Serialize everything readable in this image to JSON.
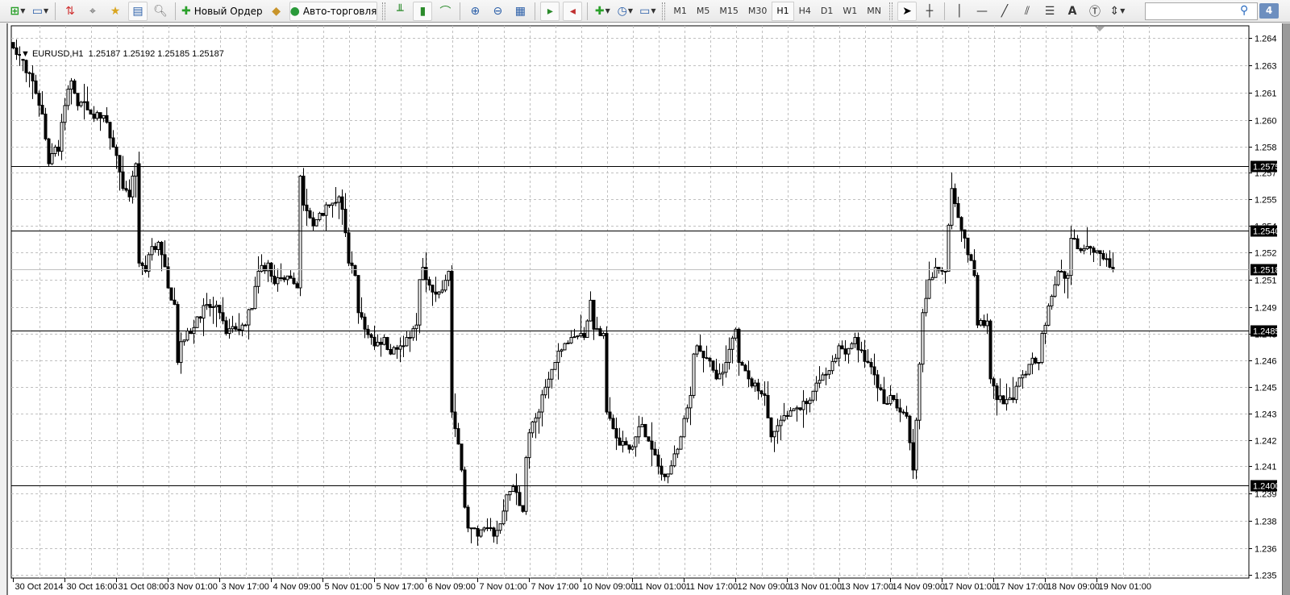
{
  "toolbar": {
    "new_order_label": "Новый Ордер",
    "autotrading_label": "Авто-торговля",
    "timeframes": [
      "M1",
      "M5",
      "M15",
      "M30",
      "H1",
      "H4",
      "D1",
      "W1",
      "MN"
    ],
    "active_timeframe": "H1",
    "search_placeholder": "",
    "badge_count": "4"
  },
  "chart_header": {
    "symbol": "EURUSD,H1",
    "ohlc": "1.25187 1.25192 1.25185 1.25187"
  },
  "colors": {
    "bull_fill": "#ffffff",
    "bear_fill": "#000000",
    "grid": "#c0c0c0",
    "hline": "#000000",
    "current_line": "#c0c0c0",
    "label_bg": "#000000"
  },
  "chart_data": {
    "type": "candlestick",
    "symbol": "EURUSD",
    "timeframe": "H1",
    "ylim": [
      1.2348,
      1.2652
    ],
    "price_ticks": [
      "1.26455",
      "1.26305",
      "1.26155",
      "1.26005",
      "1.25860",
      "1.25715",
      "1.25570",
      "1.25425",
      "1.25280",
      "1.25130",
      "1.24980",
      "1.24830",
      "1.24685",
      "1.24540",
      "1.24395",
      "1.24250",
      "1.24105",
      "1.23955",
      "1.23805",
      "1.23655",
      "1.23510"
    ],
    "time_labels": [
      "30 Oct 2014",
      "30 Oct 16:00",
      "31 Oct 08:00",
      "3 Nov 01:00",
      "3 Nov 17:00",
      "4 Nov 09:00",
      "5 Nov 01:00",
      "5 Nov 17:00",
      "6 Nov 09:00",
      "7 Nov 01:00",
      "7 Nov 17:00",
      "10 Nov 09:00",
      "11 Nov 01:00",
      "11 Nov 17:00",
      "12 Nov 09:00",
      "13 Nov 01:00",
      "13 Nov 17:00",
      "14 Nov 09:00",
      "17 Nov 01:00",
      "17 Nov 17:00",
      "18 Nov 09:00",
      "19 Nov 01:00"
    ],
    "bars_per_time_label": 16,
    "horizontal_lines": [
      "1.25750",
      "1.25400",
      "1.24850",
      "1.24000"
    ],
    "current_price": "1.25187",
    "close_path": [
      [
        0,
        1.264
      ],
      [
        1,
        1.26364
      ],
      [
        3,
        1.26332
      ],
      [
        4,
        1.26264
      ],
      [
        6,
        1.26219
      ],
      [
        9,
        1.26037
      ],
      [
        10,
        1.25901
      ],
      [
        11,
        1.25765
      ],
      [
        13,
        1.25856
      ],
      [
        14,
        1.25833
      ],
      [
        15,
        1.25992
      ],
      [
        17,
        1.26174
      ],
      [
        18,
        1.26219
      ],
      [
        19,
        1.26151
      ],
      [
        20,
        1.26083
      ],
      [
        22,
        1.26105
      ],
      [
        23,
        1.2606
      ],
      [
        24,
        1.26037
      ],
      [
        27,
        1.26015
      ],
      [
        29,
        1.25992
      ],
      [
        31,
        1.25856
      ],
      [
        32,
        1.2581
      ],
      [
        33,
        1.2572
      ],
      [
        34,
        1.25629
      ],
      [
        36,
        1.25583
      ],
      [
        37,
        1.25697
      ],
      [
        38,
        1.25765
      ],
      [
        39,
        1.2522
      ],
      [
        41,
        1.25175
      ],
      [
        42,
        1.25266
      ],
      [
        43,
        1.25311
      ],
      [
        45,
        1.25334
      ],
      [
        46,
        1.25266
      ],
      [
        48,
        1.25084
      ],
      [
        50,
        1.24993
      ],
      [
        51,
        1.24675
      ],
      [
        52,
        1.24789
      ],
      [
        55,
        1.24834
      ],
      [
        57,
        1.24925
      ],
      [
        60,
        1.24993
      ],
      [
        64,
        1.24948
      ],
      [
        66,
        1.24834
      ],
      [
        69,
        1.24857
      ],
      [
        71,
        1.2488
      ],
      [
        74,
        1.24971
      ],
      [
        76,
        1.25175
      ],
      [
        79,
        1.2522
      ],
      [
        81,
        1.25107
      ],
      [
        84,
        1.25129
      ],
      [
        87,
        1.25107
      ],
      [
        88,
        1.25084
      ],
      [
        89,
        1.25697
      ],
      [
        90,
        1.25538
      ],
      [
        93,
        1.25424
      ],
      [
        95,
        1.25493
      ],
      [
        98,
        1.25538
      ],
      [
        101,
        1.25583
      ],
      [
        102,
        1.25515
      ],
      [
        104,
        1.2522
      ],
      [
        106,
        1.25152
      ],
      [
        107,
        1.24948
      ],
      [
        109,
        1.24857
      ],
      [
        112,
        1.24766
      ],
      [
        115,
        1.24812
      ],
      [
        117,
        1.24721
      ],
      [
        120,
        1.24766
      ],
      [
        122,
        1.24812
      ],
      [
        125,
        1.2488
      ],
      [
        126,
        1.25129
      ],
      [
        127,
        1.25197
      ],
      [
        128,
        1.25129
      ],
      [
        130,
        1.25061
      ],
      [
        132,
        1.25061
      ],
      [
        135,
        1.25175
      ],
      [
        136,
        1.24403
      ],
      [
        137,
        1.24312
      ],
      [
        139,
        1.24085
      ],
      [
        140,
        1.23881
      ],
      [
        141,
        1.23767
      ],
      [
        144,
        1.23722
      ],
      [
        146,
        1.23767
      ],
      [
        149,
        1.23722
      ],
      [
        151,
        1.2379
      ],
      [
        153,
        1.23949
      ],
      [
        155,
        1.23994
      ],
      [
        158,
        1.23858
      ],
      [
        159,
        1.24153
      ],
      [
        160,
        1.24289
      ],
      [
        163,
        1.24403
      ],
      [
        165,
        1.24539
      ],
      [
        168,
        1.24675
      ],
      [
        170,
        1.24744
      ],
      [
        173,
        1.24812
      ],
      [
        176,
        1.24834
      ],
      [
        177,
        1.24812
      ],
      [
        179,
        1.25016
      ],
      [
        180,
        1.24857
      ],
      [
        183,
        1.24834
      ],
      [
        184,
        1.24403
      ],
      [
        186,
        1.24312
      ],
      [
        188,
        1.24221
      ],
      [
        191,
        1.24199
      ],
      [
        193,
        1.24267
      ],
      [
        195,
        1.24335
      ],
      [
        196,
        1.24267
      ],
      [
        198,
        1.24199
      ],
      [
        201,
        1.24062
      ],
      [
        204,
        1.24108
      ],
      [
        206,
        1.24199
      ],
      [
        207,
        1.24267
      ],
      [
        210,
        1.24494
      ],
      [
        211,
        1.24721
      ],
      [
        212,
        1.24766
      ],
      [
        215,
        1.24698
      ],
      [
        218,
        1.24585
      ],
      [
        221,
        1.24675
      ],
      [
        224,
        1.24857
      ],
      [
        225,
        1.24675
      ],
      [
        228,
        1.24585
      ],
      [
        230,
        1.24562
      ],
      [
        233,
        1.24494
      ],
      [
        235,
        1.24267
      ],
      [
        238,
        1.24358
      ],
      [
        240,
        1.2438
      ],
      [
        243,
        1.24426
      ],
      [
        246,
        1.24449
      ],
      [
        248,
        1.24517
      ],
      [
        251,
        1.24607
      ],
      [
        253,
        1.2463
      ],
      [
        256,
        1.24766
      ],
      [
        258,
        1.24721
      ],
      [
        261,
        1.24812
      ],
      [
        262,
        1.24744
      ],
      [
        265,
        1.24675
      ],
      [
        267,
        1.24607
      ],
      [
        270,
        1.24449
      ],
      [
        272,
        1.24494
      ],
      [
        275,
        1.24403
      ],
      [
        277,
        1.2438
      ],
      [
        279,
        1.24085
      ],
      [
        280,
        1.24358
      ],
      [
        282,
        1.24948
      ],
      [
        284,
        1.25129
      ],
      [
        286,
        1.25197
      ],
      [
        288,
        1.25175
      ],
      [
        289,
        1.25175
      ],
      [
        291,
        1.25629
      ],
      [
        293,
        1.2547
      ],
      [
        294,
        1.25402
      ],
      [
        296,
        1.25266
      ],
      [
        298,
        1.25152
      ],
      [
        299,
        1.2488
      ],
      [
        302,
        1.24902
      ],
      [
        303,
        1.24585
      ],
      [
        305,
        1.24471
      ],
      [
        308,
        1.24471
      ],
      [
        310,
        1.24471
      ],
      [
        313,
        1.24607
      ],
      [
        316,
        1.24698
      ],
      [
        318,
        1.24675
      ],
      [
        319,
        1.24834
      ],
      [
        322,
        1.25038
      ],
      [
        324,
        1.25175
      ],
      [
        327,
        1.25152
      ],
      [
        328,
        1.25356
      ],
      [
        331,
        1.25288
      ],
      [
        333,
        1.25311
      ],
      [
        336,
        1.25288
      ],
      [
        338,
        1.25243
      ],
      [
        340,
        1.25197
      ],
      [
        341,
        1.25187
      ]
    ]
  }
}
